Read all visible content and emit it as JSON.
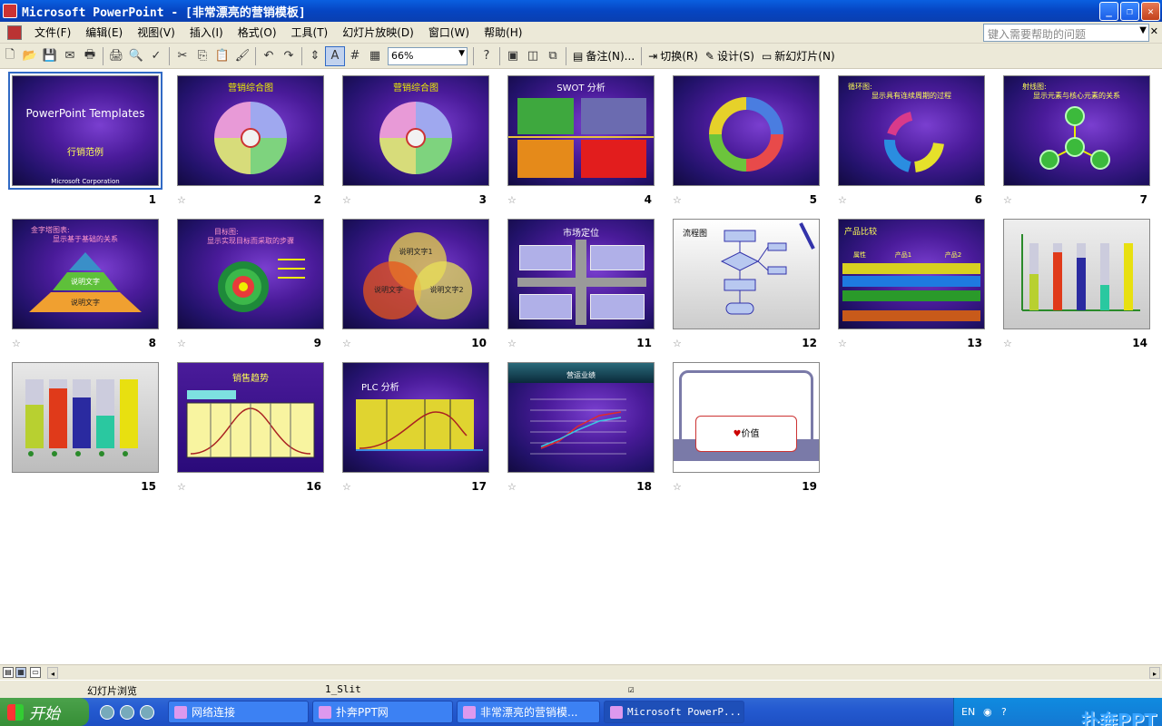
{
  "window": {
    "title": "Microsoft PowerPoint - [非常漂亮的营销模板]"
  },
  "menu": {
    "items": [
      "文件(F)",
      "编辑(E)",
      "视图(V)",
      "插入(I)",
      "格式(O)",
      "工具(T)",
      "幻灯片放映(D)",
      "窗口(W)",
      "帮助(H)"
    ],
    "help_placeholder": "键入需要帮助的问题"
  },
  "toolbar": {
    "zoom": "66%",
    "notes": "备注(N)...",
    "transition": "切换(R)",
    "design": "设计(S)",
    "new_slide": "新幻灯片(N)"
  },
  "slides": [
    {
      "num": "1",
      "title": "PowerPoint Templates",
      "sub": "行销范例",
      "foot": "Microsoft Corporation"
    },
    {
      "num": "2",
      "title": "营销综合图"
    },
    {
      "num": "3",
      "title": "营销综合图"
    },
    {
      "num": "4",
      "title": "SWOT 分析"
    },
    {
      "num": "5",
      "title": ""
    },
    {
      "num": "6",
      "title": "循环图:",
      "sub": "显示具有连续周期的过程"
    },
    {
      "num": "7",
      "title": "射线图:",
      "sub": "显示元素与核心元素的关系"
    },
    {
      "num": "8",
      "title": "金字塔图表:",
      "sub": "显示基于基础的关系",
      "labels": [
        "",
        "说明文字",
        "说明文字"
      ]
    },
    {
      "num": "9",
      "title": "目标图:",
      "sub": "显示实现目标而采取的步骤"
    },
    {
      "num": "10",
      "labels": [
        "说明文字1",
        "说明文字",
        "说明文字2"
      ]
    },
    {
      "num": "11",
      "title": "市场定位"
    },
    {
      "num": "12",
      "title": "流程图"
    },
    {
      "num": "13",
      "title": "产品比较",
      "labels": [
        "属性",
        "产品1",
        "产品2"
      ]
    },
    {
      "num": "14"
    },
    {
      "num": "15"
    },
    {
      "num": "16",
      "title": "销售趋势"
    },
    {
      "num": "17",
      "title": "PLC 分析"
    },
    {
      "num": "18",
      "title": "营运业绩"
    },
    {
      "num": "19",
      "title": "价值"
    }
  ],
  "status": {
    "view": "幻灯片浏览",
    "design": "1_Slit"
  },
  "taskbar": {
    "start": "开始",
    "tasks": [
      "网络连接",
      "扑奔PPT网",
      "非常漂亮的营销模...",
      "Microsoft PowerP..."
    ],
    "lang": "EN",
    "logo": "扑奔PPT"
  }
}
